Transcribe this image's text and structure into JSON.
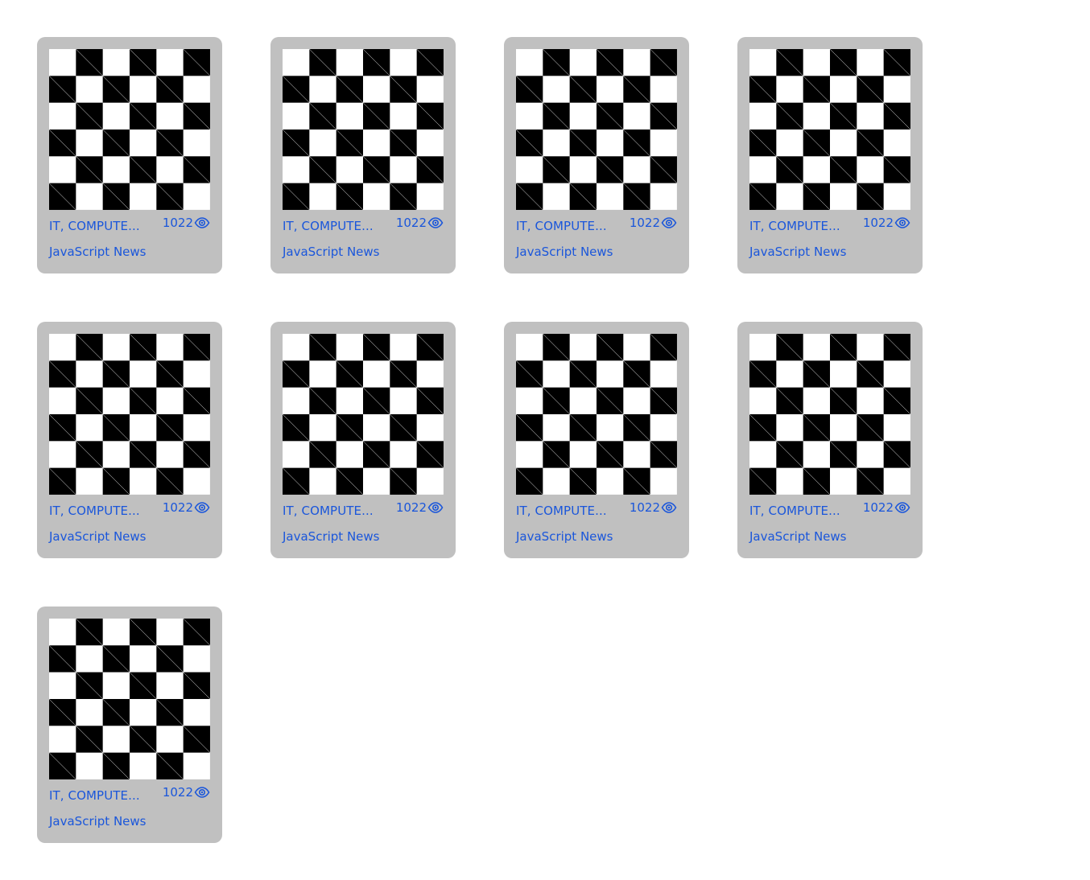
{
  "cards": [
    {
      "category": "IT, COMPUTE...",
      "views": "1022",
      "source": "JavaScript News",
      "thumb_icon": "checkerboard-thumbnail",
      "view_icon": "eye-icon"
    },
    {
      "category": "IT, COMPUTE...",
      "views": "1022",
      "source": "JavaScript News",
      "thumb_icon": "checkerboard-thumbnail",
      "view_icon": "eye-icon"
    },
    {
      "category": "IT, COMPUTE...",
      "views": "1022",
      "source": "JavaScript News",
      "thumb_icon": "checkerboard-thumbnail",
      "view_icon": "eye-icon"
    },
    {
      "category": "IT, COMPUTE...",
      "views": "1022",
      "source": "JavaScript News",
      "thumb_icon": "checkerboard-thumbnail",
      "view_icon": "eye-icon"
    },
    {
      "category": "IT, COMPUTE...",
      "views": "1022",
      "source": "JavaScript News",
      "thumb_icon": "checkerboard-thumbnail",
      "view_icon": "eye-icon"
    },
    {
      "category": "IT, COMPUTE...",
      "views": "1022",
      "source": "JavaScript News",
      "thumb_icon": "checkerboard-thumbnail",
      "view_icon": "eye-icon"
    },
    {
      "category": "IT, COMPUTE...",
      "views": "1022",
      "source": "JavaScript News",
      "thumb_icon": "checkerboard-thumbnail",
      "view_icon": "eye-icon"
    },
    {
      "category": "IT, COMPUTE...",
      "views": "1022",
      "source": "JavaScript News",
      "thumb_icon": "checkerboard-thumbnail",
      "view_icon": "eye-icon"
    },
    {
      "category": "IT, COMPUTE...",
      "views": "1022",
      "source": "JavaScript News",
      "thumb_icon": "checkerboard-thumbnail",
      "view_icon": "eye-icon"
    }
  ],
  "colors": {
    "card_background": "#c0c0c0",
    "text_accent": "#1a56db",
    "page_background": "#ffffff"
  }
}
